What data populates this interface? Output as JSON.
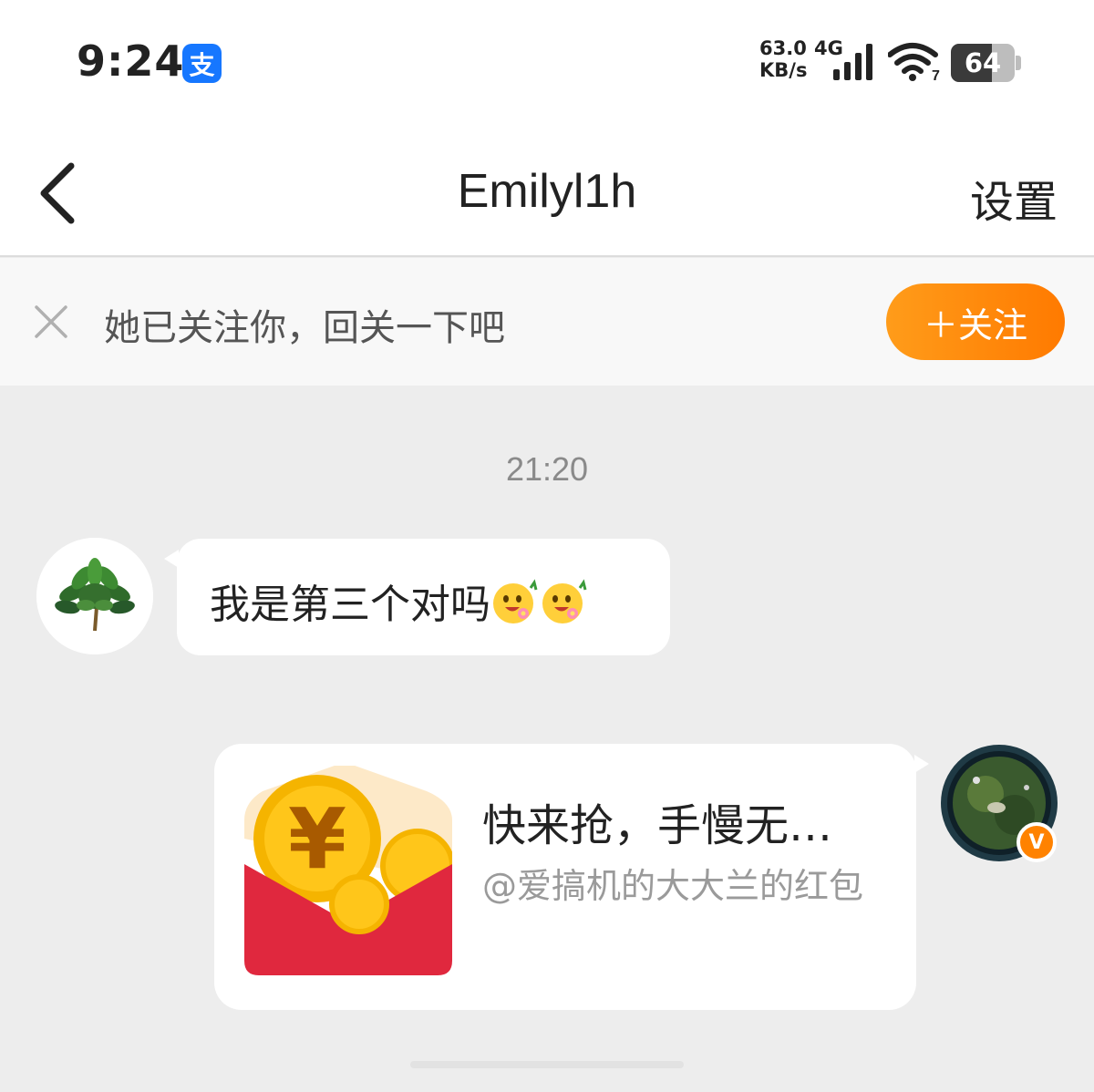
{
  "status_bar": {
    "time": "9:24",
    "app_icon": "alipay-icon",
    "app_icon_glyph": "支",
    "net_speed_value": "63.0",
    "net_speed_unit": "KB/s",
    "network_type": "4G",
    "wifi_label": "7",
    "battery_level": 64,
    "battery_text": "64"
  },
  "nav": {
    "title": "Emilyl1h",
    "settings_label": "设置",
    "back_icon": "chevron-left-icon"
  },
  "banner": {
    "text": "她已关注你，回关一下吧",
    "follow_label": "＋关注",
    "close_icon": "close-icon"
  },
  "chat": {
    "timestamp": "21:20",
    "messages": [
      {
        "side": "left",
        "text": "我是第三个对吗",
        "emojis": [
          "flower-face-emoji",
          "flower-face-emoji"
        ],
        "avatar": "leaf-bouquet-avatar"
      },
      {
        "side": "right",
        "type": "red-packet-card",
        "title": "快来抢，手慢无…",
        "subtitle": "@爱搞机的大大兰的红包",
        "avatar": "aerial-view-avatar",
        "badge_glyph": "V"
      }
    ]
  },
  "colors": {
    "accent": "#ff8200",
    "background": "#ededed",
    "alipay": "#1677ff",
    "red_packet": "#e0283e",
    "coin": "#f5b400"
  }
}
